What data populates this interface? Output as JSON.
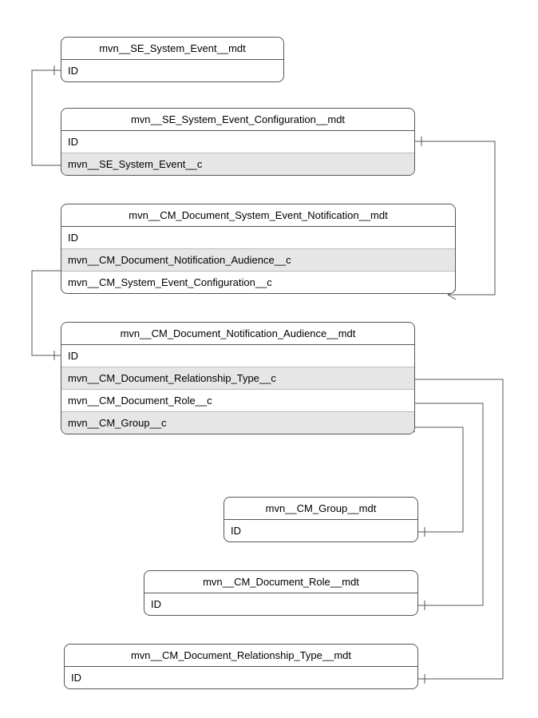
{
  "entities": [
    {
      "key": "e0",
      "title": "mvn__SE_System_Event__mdt",
      "rows": [
        {
          "key": "r0",
          "label": "ID",
          "shaded": false
        }
      ]
    },
    {
      "key": "e1",
      "title": "mvn__SE_System_Event_Configuration__mdt",
      "rows": [
        {
          "key": "r0",
          "label": "ID",
          "shaded": false
        },
        {
          "key": "r1",
          "label": "mvn__SE_System_Event__c",
          "shaded": true
        }
      ]
    },
    {
      "key": "e2",
      "title": "mvn__CM_Document_System_Event_Notification__mdt",
      "rows": [
        {
          "key": "r0",
          "label": "ID",
          "shaded": false
        },
        {
          "key": "r1",
          "label": "mvn__CM_Document_Notification_Audience__c",
          "shaded": true
        },
        {
          "key": "r2",
          "label": "mvn__CM_System_Event_Configuration__c",
          "shaded": false
        }
      ]
    },
    {
      "key": "e3",
      "title": "mvn__CM_Document_Notification_Audience__mdt",
      "rows": [
        {
          "key": "r0",
          "label": "ID",
          "shaded": false
        },
        {
          "key": "r1",
          "label": "mvn__CM_Document_Relationship_Type__c",
          "shaded": true
        },
        {
          "key": "r2",
          "label": "mvn__CM_Document_Role__c",
          "shaded": false
        },
        {
          "key": "r3",
          "label": "mvn__CM_Group__c",
          "shaded": true
        }
      ]
    },
    {
      "key": "e4",
      "title": "mvn__CM_Group__mdt",
      "rows": [
        {
          "key": "r0",
          "label": "ID",
          "shaded": false
        }
      ]
    },
    {
      "key": "e5",
      "title": "mvn__CM_Document_Role__mdt",
      "rows": [
        {
          "key": "r0",
          "label": "ID",
          "shaded": false
        }
      ]
    },
    {
      "key": "e6",
      "title": "mvn__CM_Document_Relationship_Type__mdt",
      "rows": [
        {
          "key": "r0",
          "label": "ID",
          "shaded": false
        }
      ]
    }
  ]
}
